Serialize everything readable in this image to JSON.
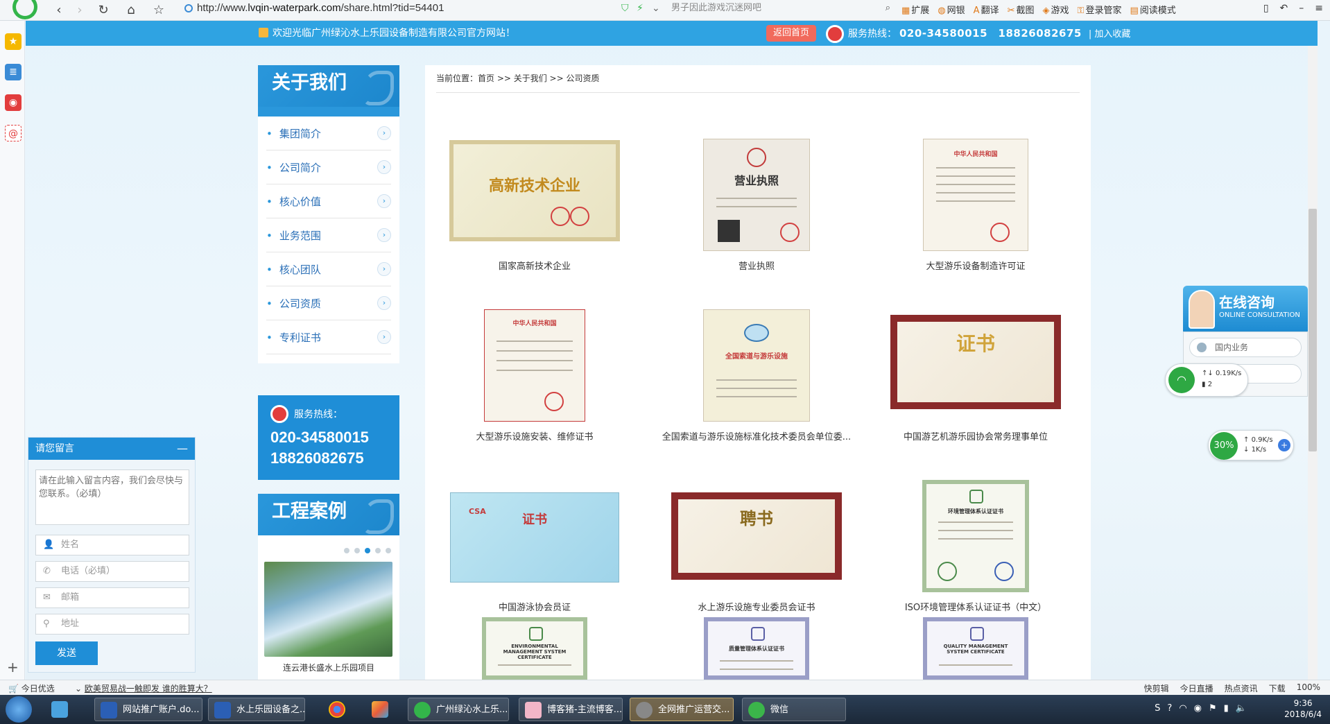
{
  "browser": {
    "url_prefix": "http://www.",
    "url_domain": "lvqin-waterpark.com",
    "url_path": "/share.html?tid=54401",
    "search_placeholder": "男子因此游戏沉迷网吧",
    "tools": [
      "扩展",
      "网银",
      "翻译",
      "截图",
      "游戏",
      "登录管家",
      "阅读模式"
    ]
  },
  "header": {
    "welcome": "欢迎光临广州绿沁水上乐园设备制造有限公司官方网站！",
    "home_button": "返回首页",
    "hotline_label": "服务热线：",
    "hotline_numbers": "020-34580015　18826082675",
    "favorite": "加入收藏"
  },
  "sidebar": {
    "title": "关于我们",
    "items": [
      {
        "label": "集团简介"
      },
      {
        "label": "公司简介"
      },
      {
        "label": "核心价值"
      },
      {
        "label": "业务范围"
      },
      {
        "label": "核心团队"
      },
      {
        "label": "公司资质"
      },
      {
        "label": "专利证书"
      }
    ],
    "hotline_label": "服务热线：",
    "hotline_1": "020-34580015",
    "hotline_2": "18826082675",
    "cases_title": "工程案例",
    "case_caption": "连云港长盛水上乐园项目"
  },
  "breadcrumb": "当前位置：首页 >> 关于我们 >> 公司资质",
  "certificates": [
    {
      "caption": "国家高新技术企业",
      "text": "高新技术企业"
    },
    {
      "caption": "营业执照",
      "text": "营业执照"
    },
    {
      "caption": "大型游乐设备制造许可证",
      "text": "中华人民共和国"
    },
    {
      "caption": "大型游乐设施安装、维修证书",
      "text": "中华人民共和国"
    },
    {
      "caption": "全国索道与游乐设施标准化技术委员会单位委...",
      "text": "全国索道与游乐设施"
    },
    {
      "caption": "中国游艺机游乐园协会常务理事单位",
      "text": "证书"
    },
    {
      "caption": "中国游泳协会员证",
      "text": "证书"
    },
    {
      "caption": "水上游乐设施专业委员会证书",
      "text": "聘书"
    },
    {
      "caption": "ISO环境管理体系认证证书（中文）",
      "text": "环境管理体系认证证书"
    },
    {
      "caption": "",
      "text": "ENVIRONMENTAL MANAGEMENT SYSTEM CERTIFICATE"
    },
    {
      "caption": "",
      "text": "质量管理体系认证证书"
    },
    {
      "caption": "",
      "text": "QUALITY MANAGEMENT SYSTEM CERTIFICATE"
    }
  ],
  "consult": {
    "title": "在线咨询",
    "subtitle": "ONLINE CONSULTATION",
    "option_1": "国内业务",
    "option_2": ""
  },
  "net_widget": {
    "speed": "0.19K/s",
    "count": "2"
  },
  "speed_widget": {
    "percent": "30%",
    "up": "0.9K/s",
    "down": "1K/s"
  },
  "message": {
    "title": "请您留言",
    "placeholder": "请在此输入留言内容，我们会尽快与您联系。（必填）",
    "name": "姓名",
    "phone": "电话（必填）",
    "email": "邮箱",
    "address": "地址",
    "send": "发送"
  },
  "statusbar": {
    "left_1": "今日优选",
    "left_2": "欧美贸易战一触即发 谁的胜算大？",
    "right": [
      "快剪辑",
      "今日直播",
      "热点资讯",
      "下载",
      "100%"
    ]
  },
  "taskbar": {
    "apps": [
      "网站推广账户.do...",
      "水上乐园设备之...",
      "",
      "",
      "广州绿沁水上乐...",
      "博客猪-主流博客...",
      "全网推广运营交...",
      "微信"
    ],
    "time": "9:36",
    "date": "2018/6/4"
  }
}
